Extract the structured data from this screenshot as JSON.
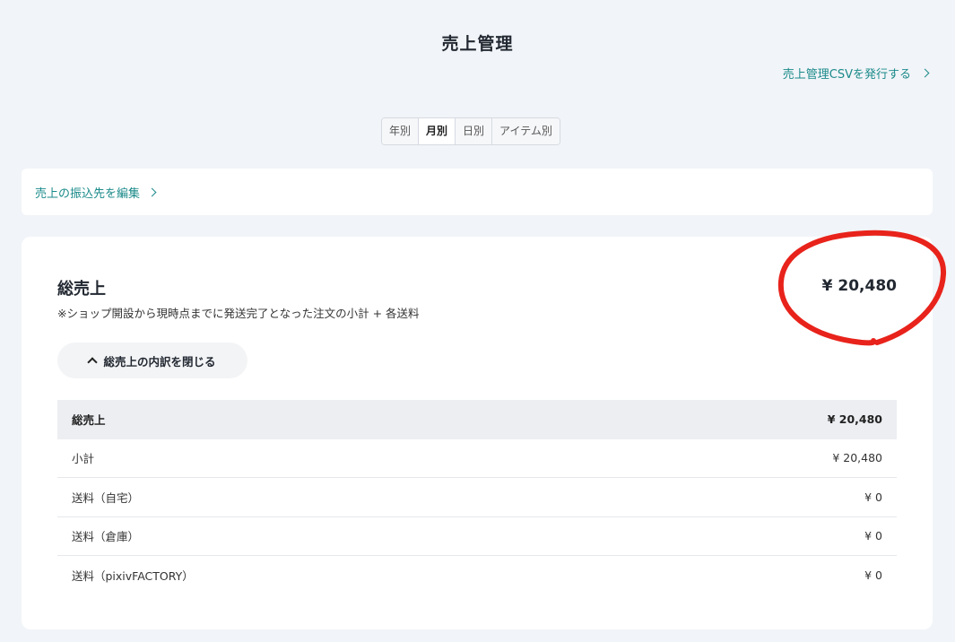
{
  "header": {
    "title": "売上管理",
    "csv_link": "売上管理CSVを発行する"
  },
  "tabs": [
    {
      "label": "年別",
      "active": false
    },
    {
      "label": "月別",
      "active": true
    },
    {
      "label": "日別",
      "active": false
    },
    {
      "label": "アイテム別",
      "active": false
    }
  ],
  "transfer": {
    "link": "売上の振込先を編集"
  },
  "summary": {
    "title": "総売上",
    "note": "※ショップ開設から現時点までに発送完了となった注文の小計 + 各送料",
    "amount": "¥ 20,480",
    "toggle_label": "総売上の内訳を閉じる"
  },
  "breakdown": [
    {
      "label": "総売上",
      "value": "¥ 20,480"
    },
    {
      "label": "小計",
      "value": "¥ 20,480"
    },
    {
      "label": "送料（自宅）",
      "value": "¥ 0"
    },
    {
      "label": "送料（倉庫）",
      "value": "¥ 0"
    },
    {
      "label": "送料（pixivFACTORY）",
      "value": "¥ 0"
    }
  ],
  "colors": {
    "background": "#f1f4f8",
    "link": "#1b8a8a",
    "annotation": "#e8231b"
  }
}
